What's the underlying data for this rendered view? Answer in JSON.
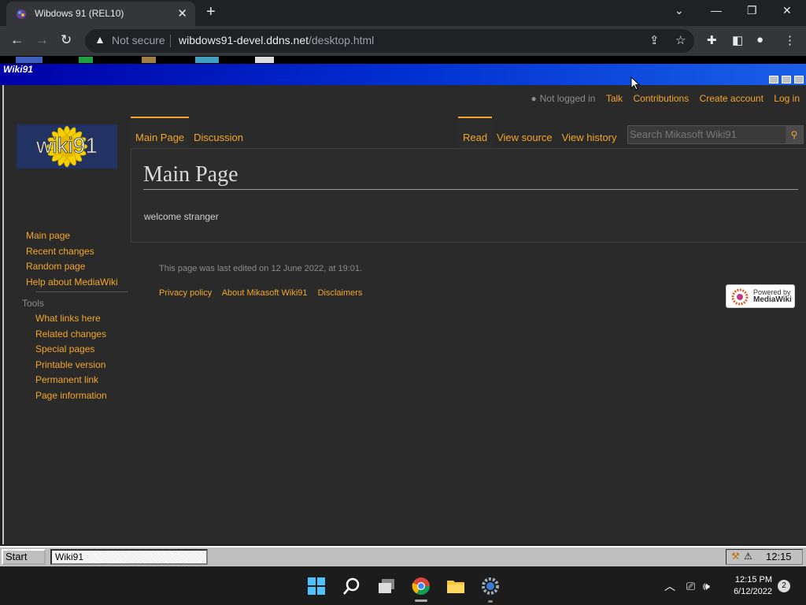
{
  "browser": {
    "tab_title": "Wibdows 91 (REL10)",
    "tab_close": "✕",
    "new_tab": "+",
    "security_label": "Not secure",
    "url_host": "wibdows91-devel.ddns.net",
    "url_path": "/desktop.html"
  },
  "w91": {
    "window_title": "Wiki91",
    "start_label": "Start",
    "task_label": "Wiki91",
    "tray_time": "12:15"
  },
  "wiki": {
    "personal": {
      "not_logged_in": "Not logged in",
      "talk": "Talk",
      "contributions": "Contributions",
      "create_account": "Create account",
      "login": "Log in"
    },
    "logo_text": "wiki91",
    "tabs_left": [
      "Main Page",
      "Discussion"
    ],
    "tabs_right": [
      "Read",
      "View source",
      "View history"
    ],
    "search_placeholder": "Search Mikasoft Wiki91",
    "heading": "Main Page",
    "body": "welcome stranger",
    "nav_main": [
      "Main page",
      "Recent changes",
      "Random page",
      "Help about MediaWiki"
    ],
    "tools_heading": "Tools",
    "nav_tools": [
      "What links here",
      "Related changes",
      "Special pages",
      "Printable version",
      "Permanent link",
      "Page information"
    ],
    "footer_edit": "This page was last edited on 12 June 2022, at 19:01.",
    "footer_links": [
      "Privacy policy",
      "About Mikasoft Wiki91",
      "Disclaimers"
    ],
    "powered_by": "Powered by",
    "powered_name": "MediaWiki"
  },
  "taskbar": {
    "time": "12:15 PM",
    "date": "6/12/2022",
    "notifications": "2"
  },
  "colors": {
    "link": "#f2a62b",
    "chrome_bg": "#202124",
    "wiki_bg": "#2a2a2a"
  }
}
